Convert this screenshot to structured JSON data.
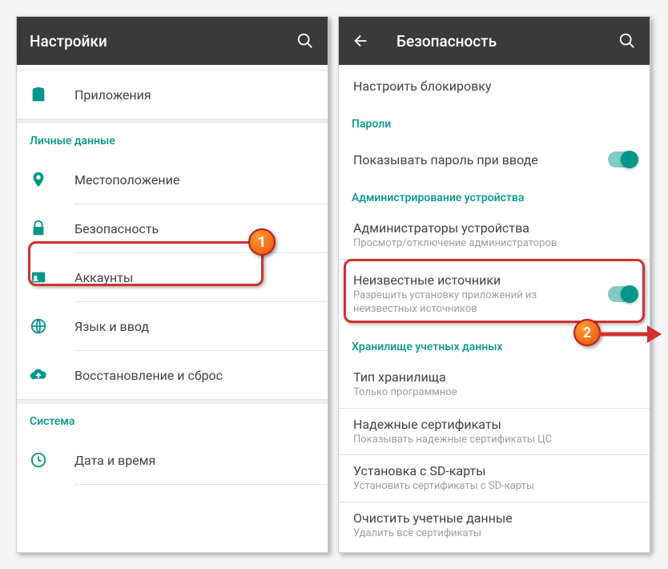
{
  "left": {
    "title": "Настройки",
    "item_apps": "Приложения",
    "section_personal": "Личные данные",
    "item_location": "Местоположение",
    "item_security": "Безопасность",
    "item_accounts": "Аккаунты",
    "item_language": "Язык и ввод",
    "item_backup": "Восстановление и сброс",
    "section_system": "Система",
    "item_datetime": "Дата и время"
  },
  "right": {
    "title": "Безопасность",
    "item_configlock": "Настроить блокировку",
    "section_passwords": "Пароли",
    "item_showpass": "Показывать пароль при вводе",
    "section_admin": "Администрирование устройства",
    "item_admins_t": "Администраторы устройства",
    "item_admins_s": "Просмотр/отключение администраторов",
    "item_unknown_t": "Неизвестные источники",
    "item_unknown_s": "Разрешить установку приложений из неизвестных источников",
    "section_creds": "Хранилище учетных данных",
    "item_storage_t": "Тип хранилища",
    "item_storage_s": "Только программное",
    "item_trusted_t": "Надежные сертификаты",
    "item_trusted_s": "Показывать надежные сертификаты ЦС",
    "item_sd_t": "Установка с SD-карты",
    "item_sd_s": "Установить сертификаты с SD-карты",
    "item_clear_t": "Очистить учетные данные",
    "item_clear_s": "Удалить все сертификаты"
  },
  "badges": {
    "one": "1",
    "two": "2"
  }
}
